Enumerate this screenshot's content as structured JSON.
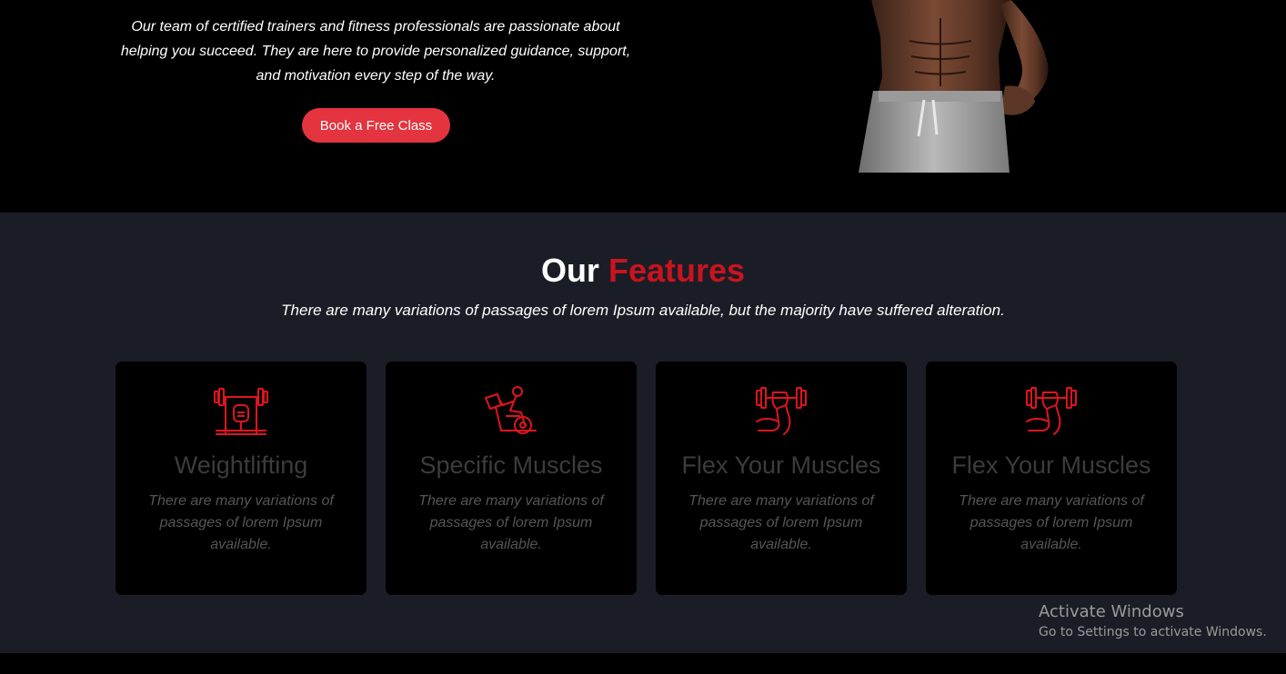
{
  "hero": {
    "text": "Our team of certified trainers and fitness professionals are passionate about helping you succeed. They are here to provide personalized guidance, support, and motivation every step of the way.",
    "cta_label": "Book a Free Class"
  },
  "features": {
    "title_part1": "Our",
    "title_part2": "Features",
    "subtitle": "There are many variations of passages of lorem Ipsum available, but the majority have suffered alteration.",
    "cards": [
      {
        "icon": "bench-press-icon",
        "title": "Weightlifting",
        "text": "There are many variations of passages of lorem Ipsum available."
      },
      {
        "icon": "exercise-bike-icon",
        "title": "Specific Muscles",
        "text": "There are many variations of passages of lorem Ipsum available."
      },
      {
        "icon": "flex-dumbbell-icon",
        "title": "Flex Your Muscles",
        "text": "There are many variations of passages of lorem Ipsum available."
      },
      {
        "icon": "flex-dumbbell-icon",
        "title": "Flex Your Muscles",
        "text": "There are many variations of passages of lorem Ipsum available."
      }
    ]
  },
  "watermark": {
    "title": "Activate Windows",
    "subtitle": "Go to Settings to activate Windows."
  },
  "colors": {
    "accent_red": "#c8141e",
    "button_red": "#e3343f",
    "section_bg": "#1b1d26"
  }
}
